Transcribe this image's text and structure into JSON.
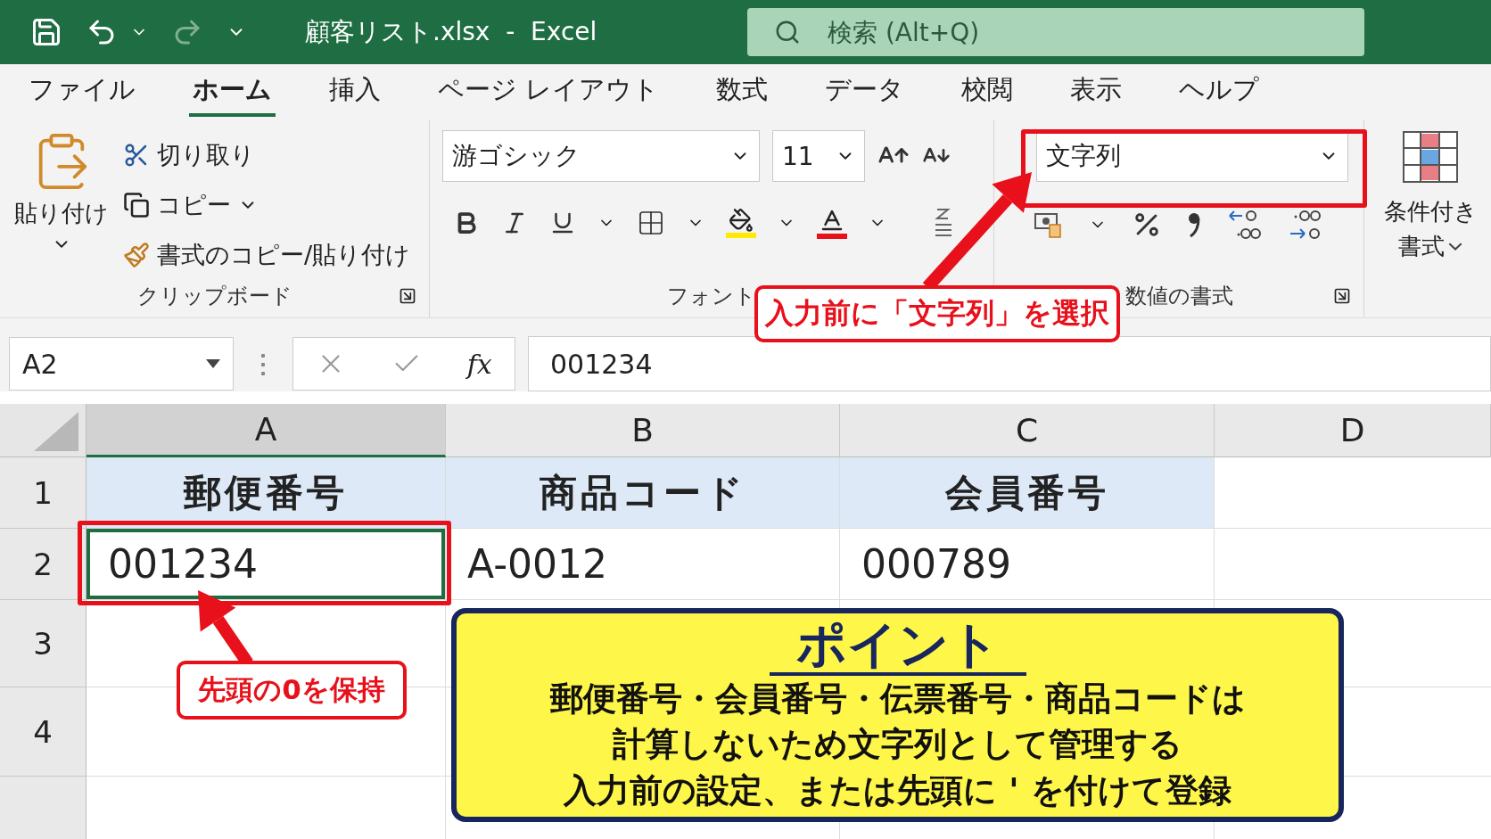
{
  "title_bar": {
    "title": "顧客リスト.xlsx  -  Excel",
    "search_placeholder": "検索 (Alt+Q)"
  },
  "ribbon_tabs": [
    {
      "label": "ファイル",
      "selected": false
    },
    {
      "label": "ホーム",
      "selected": true
    },
    {
      "label": "挿入",
      "selected": false
    },
    {
      "label": "ページ レイアウト",
      "selected": false
    },
    {
      "label": "数式",
      "selected": false
    },
    {
      "label": "データ",
      "selected": false
    },
    {
      "label": "校閲",
      "selected": false
    },
    {
      "label": "表示",
      "selected": false
    },
    {
      "label": "ヘルプ",
      "selected": false
    }
  ],
  "clipboard": {
    "paste": "貼り付け",
    "cut": "切り取り",
    "copy": "コピー",
    "format_painter": "書式のコピー/貼り付け",
    "group_label": "クリップボード"
  },
  "font": {
    "name": "游ゴシック",
    "size": "11",
    "group_label": "フォント"
  },
  "number": {
    "format": "文字列",
    "group_label": "数値の書式"
  },
  "styles": {
    "conditional_line1": "条件付き",
    "conditional_line2": "書式"
  },
  "formula_bar": {
    "name_box": "A2",
    "function_label": "fx",
    "value": "001234"
  },
  "columns": [
    {
      "label": "A",
      "selected": true
    },
    {
      "label": "B",
      "selected": false
    },
    {
      "label": "C",
      "selected": false
    },
    {
      "label": "D",
      "selected": false
    }
  ],
  "rows": [
    {
      "number": "1",
      "kind": "header",
      "cells": [
        {
          "text": "郵便番号",
          "selected": false
        },
        {
          "text": "商品コード",
          "selected": false
        },
        {
          "text": "会員番号",
          "selected": false
        }
      ]
    },
    {
      "number": "2",
      "kind": "data",
      "cells": [
        {
          "text": "001234",
          "selected": true
        },
        {
          "text": "A-0012",
          "selected": false
        },
        {
          "text": "000789",
          "selected": false
        }
      ]
    },
    {
      "number": "3"
    },
    {
      "number": "4"
    }
  ],
  "callouts": [
    "入力前に「文字列」を選択",
    "先頭の0を保持"
  ],
  "point_box": {
    "title": "ポイント",
    "lines": [
      "郵便番号・会員番号・伝票番号・商品コードは",
      "計算しないため文字列として管理する",
      "入力前の設定、または先頭に ' を付けて登録"
    ]
  }
}
